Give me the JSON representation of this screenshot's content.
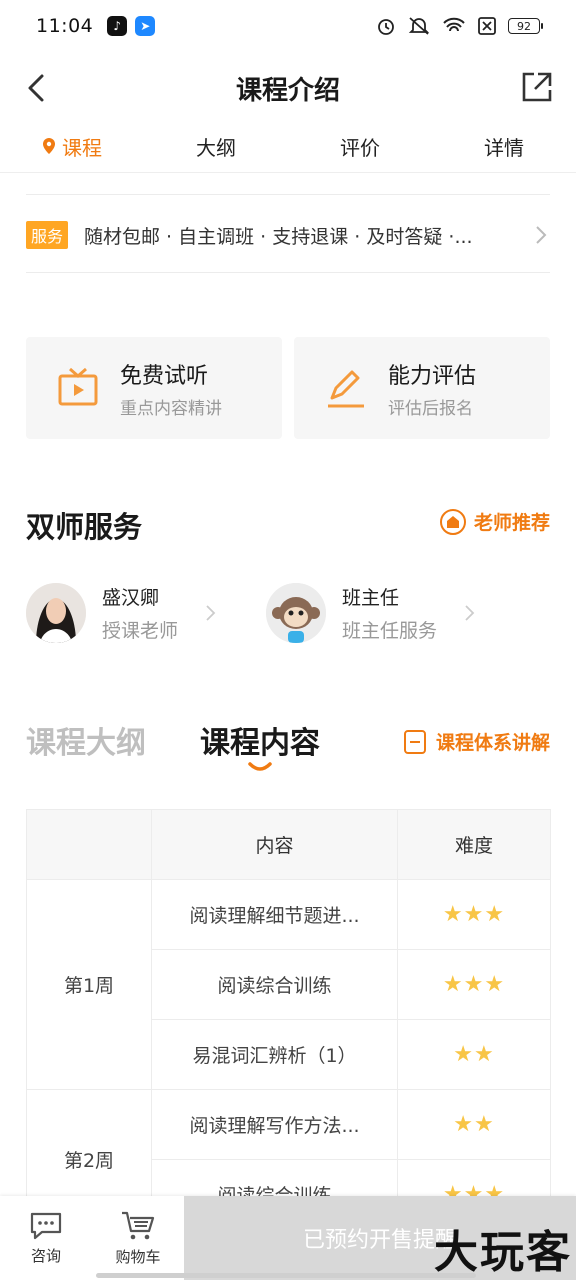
{
  "status": {
    "time": "11:04",
    "battery": "92"
  },
  "header": {
    "title": "课程介绍"
  },
  "tabs": [
    {
      "label": "课程",
      "active": true
    },
    {
      "label": "大纲",
      "active": false
    },
    {
      "label": "评价",
      "active": false
    },
    {
      "label": "详情",
      "active": false
    }
  ],
  "service": {
    "tag": "服务",
    "text": "随材包邮 · 自主调班 · 支持退课 · 及时答疑 ·..."
  },
  "cards": [
    {
      "title": "免费试听",
      "subtitle": "重点内容精讲",
      "icon": "tv-play-icon"
    },
    {
      "title": "能力评估",
      "subtitle": "评估后报名",
      "icon": "pencil-icon"
    }
  ],
  "dual_teacher": {
    "title": "双师服务",
    "recommend": "老师推荐",
    "teachers": [
      {
        "name": "盛汉卿",
        "role": "授课老师"
      },
      {
        "name": "班主任",
        "role": "班主任服务"
      }
    ]
  },
  "course_tabs": {
    "inactive": "课程大纲",
    "active": "课程内容",
    "system": "课程体系讲解"
  },
  "table": {
    "headers": [
      "",
      "内容",
      "难度"
    ],
    "weeks": [
      {
        "label": "第1周",
        "rows": [
          {
            "content": "阅读理解细节题进...",
            "difficulty": 3
          },
          {
            "content": "阅读综合训练",
            "difficulty": 3
          },
          {
            "content": "易混词汇辨析（1）",
            "difficulty": 2
          }
        ]
      },
      {
        "label": "第2周",
        "rows": [
          {
            "content": "阅读理解写作方法...",
            "difficulty": 2
          },
          {
            "content": "阅读综合训练",
            "difficulty": 3
          }
        ]
      }
    ]
  },
  "bottom": {
    "consult": "咨询",
    "cart": "购物车",
    "cta": "已预约开售提醒",
    "watermark": "大玩客"
  },
  "colors": {
    "accent": "#f07b12",
    "tag": "#ffa623",
    "star": "#f8c546"
  }
}
